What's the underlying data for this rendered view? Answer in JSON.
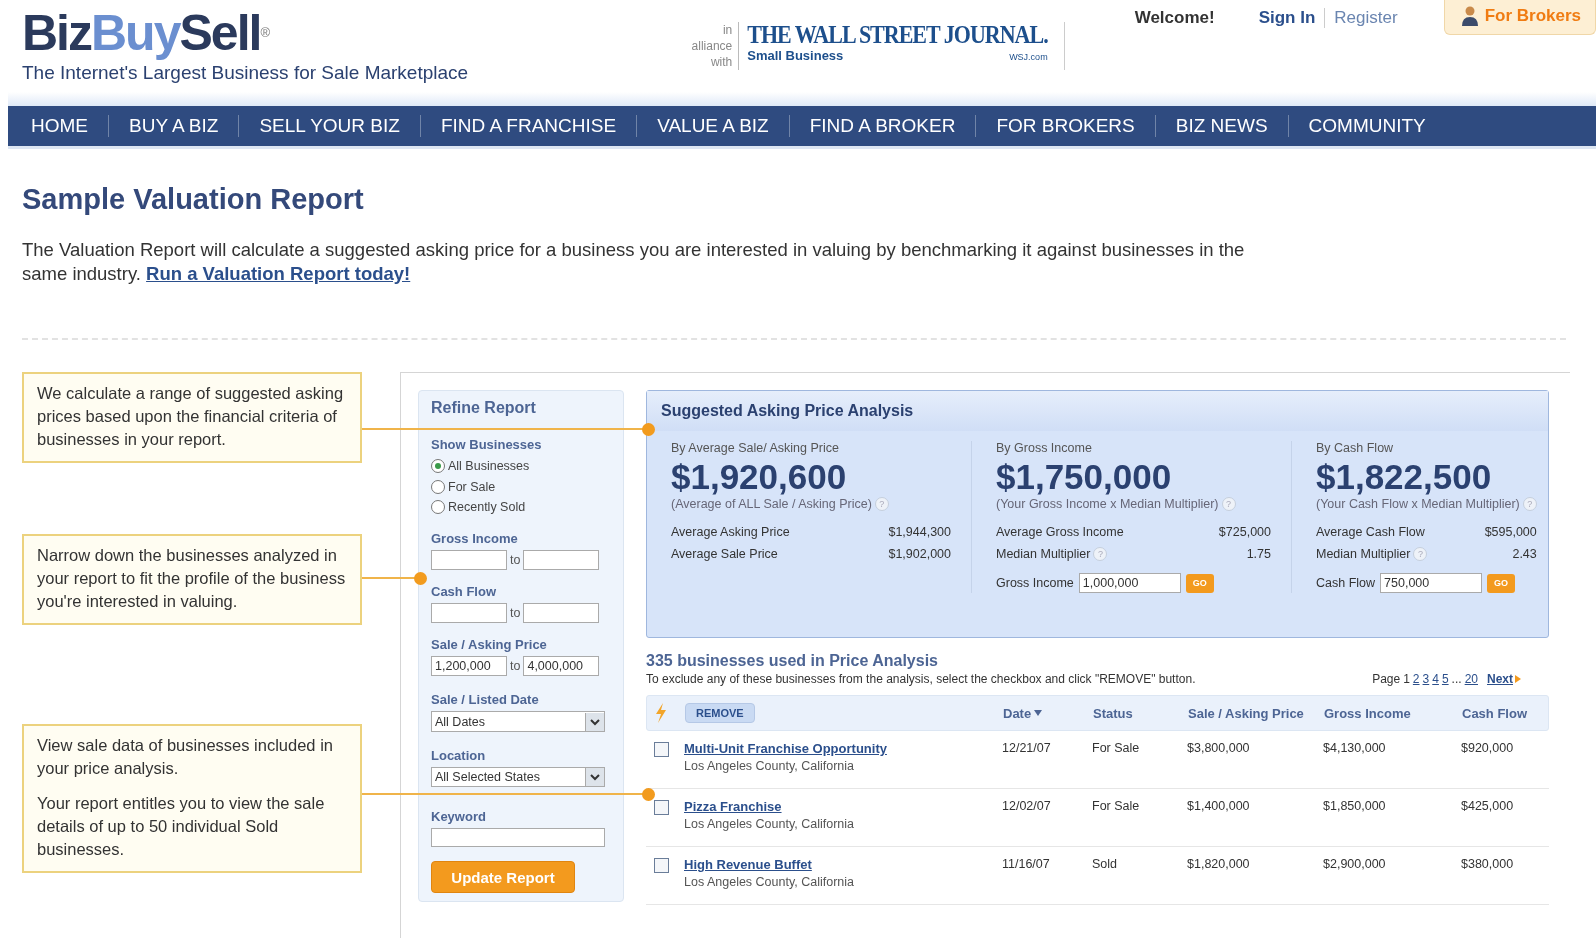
{
  "header": {
    "logo": {
      "first": "Biz",
      "second": "Buy",
      "third": "Sell",
      "mark": "®"
    },
    "tagline": "The Internet's Largest Business for Sale Marketplace",
    "alliance": {
      "prefix": "in alliance",
      "prefix2": "with",
      "name": "THE WALL STREET JOURNAL.",
      "sub": "Small Business",
      "domain": "WSJ.com"
    },
    "welcome": "Welcome!",
    "sign_in": "Sign In",
    "register": "Register",
    "for_brokers": "For Brokers"
  },
  "nav": [
    "HOME",
    "BUY A BIZ",
    "SELL YOUR BIZ",
    "FIND A FRANCHISE",
    "VALUE A BIZ",
    "FIND A BROKER",
    "FOR BROKERS",
    "BIZ NEWS",
    "COMMUNITY"
  ],
  "page_title": "Sample Valuation Report",
  "intro": {
    "text": "The Valuation Report will calculate a suggested asking price for a business you are interested in valuing by benchmarking it against businesses in the same industry.",
    "link": "Run a Valuation Report today!"
  },
  "callouts": [
    {
      "paragraphs": [
        "We calculate a range of suggested asking prices based upon the financial criteria of businesses in your report."
      ]
    },
    {
      "paragraphs": [
        "Narrow down the businesses analyzed in your report to fit the profile of the business you're interested in valuing."
      ]
    },
    {
      "paragraphs": [
        "View sale data of businesses included in your price analysis.",
        "Your report entitles you to view the sale details of up to 50 individual Sold businesses."
      ]
    }
  ],
  "refine": {
    "title": "Refine Report",
    "show_label": "Show Businesses",
    "radios": [
      {
        "label": "All Businesses",
        "selected": true
      },
      {
        "label": "For Sale",
        "selected": false
      },
      {
        "label": "Recently Sold",
        "selected": false
      }
    ],
    "ranges": [
      {
        "label": "Gross Income",
        "joiner": "to"
      },
      {
        "label": "Cash Flow",
        "joiner": "to"
      },
      {
        "label": "Sale / Asking Price",
        "from": "1,200,000",
        "joiner": "to",
        "to": "4,000,000"
      }
    ],
    "selects": [
      {
        "label": "Sale / Listed Date",
        "value": "All Dates"
      },
      {
        "label": "Location",
        "value": "All Selected States"
      }
    ],
    "keyword_label": "Keyword",
    "button": "Update Report"
  },
  "analysis": {
    "title": "Suggested Asking Price Analysis",
    "columns": [
      {
        "label": "By Average Sale/ Asking Price",
        "amount": "$1,920,600",
        "note": "(Average of ALL Sale / Asking Price)",
        "help": "?",
        "stats": [
          {
            "label": "Average Asking Price",
            "value": "$1,944,300"
          },
          {
            "label": "Average Sale Price",
            "value": "$1,902,000"
          }
        ]
      },
      {
        "label": "By Gross Income",
        "amount": "$1,750,000",
        "note": "(Your Gross Income x Median Multiplier)",
        "help": "?",
        "stats": [
          {
            "label": "Average Gross Income",
            "value": "$725,000"
          },
          {
            "label": "Median Multiplier",
            "help": "?",
            "value": "1.75"
          }
        ],
        "input": {
          "label": "Gross Income",
          "value": "1,000,000",
          "button": "GO"
        }
      },
      {
        "label": "By Cash Flow",
        "amount": "$1,822,500",
        "note": "(Your Cash Flow x Median Multiplier)",
        "help": "?",
        "stats": [
          {
            "label": "Average Cash Flow",
            "value": "$595,000"
          },
          {
            "label": "Median Multiplier",
            "help": "?",
            "value": "2.43"
          }
        ],
        "input": {
          "label": "Cash Flow",
          "value": "750,000",
          "button": "GO"
        }
      }
    ]
  },
  "table": {
    "heading": "335 businesses used in Price Analysis",
    "hint": "To exclude any of these businesses from the analysis, select the checkbox and click \"REMOVE\" button.",
    "pager": {
      "label": "Page",
      "pages": [
        {
          "label": "1",
          "selected": true
        },
        {
          "label": "2",
          "selected": false
        },
        {
          "label": "3",
          "selected": false
        },
        {
          "label": "4",
          "selected": false
        },
        {
          "label": "5",
          "selected": false
        }
      ],
      "ellipsis": "...",
      "last": "20",
      "next": "Next"
    },
    "remove": "REMOVE",
    "columns": [
      {
        "label": "Date",
        "sorted": true
      },
      {
        "label": "Status",
        "sorted": false
      },
      {
        "label": "Sale / Asking Price",
        "sorted": false
      },
      {
        "label": "Gross Income",
        "sorted": false
      },
      {
        "label": "Cash Flow",
        "sorted": false
      }
    ],
    "rows": [
      {
        "checked": false,
        "name": "Multi-Unit Franchise Opportunity",
        "location": "Los Angeles County, California",
        "date": "12/21/07",
        "status": "For Sale",
        "price": "$3,800,000",
        "gross": "$4,130,000",
        "cash_flow": "$920,000"
      },
      {
        "checked": false,
        "name": "Pizza Franchise",
        "location": "Los Angeles County, California",
        "date": "12/02/07",
        "status": "For Sale",
        "price": "$1,400,000",
        "gross": "$1,850,000",
        "cash_flow": "$425,000"
      },
      {
        "checked": false,
        "name": "High Revenue Buffet",
        "location": "Los Angeles County, California",
        "date": "11/16/07",
        "status": "Sold",
        "price": "$1,820,000",
        "gross": "$2,900,000",
        "cash_flow": "$380,000"
      }
    ]
  }
}
